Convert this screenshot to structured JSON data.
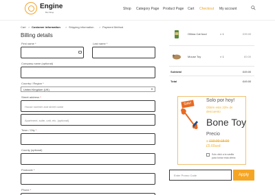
{
  "brand": {
    "name": "Engine",
    "tagline": "Bot Shop"
  },
  "nav": [
    "Shop",
    "Category Page",
    "Product Page",
    "Cart",
    "Checkout",
    "My account"
  ],
  "nav_active": "Checkout",
  "breadcrumb": {
    "items": [
      "Cart",
      "Customer information",
      "Shipping information",
      "Payment Method"
    ],
    "separator": ">"
  },
  "billing": {
    "title": "Billing details",
    "first_name_label": "First name",
    "last_name_label": "Last name",
    "company_label": "Company name (optional)",
    "country_label": "Country / Region",
    "country_value": "United Kingdom (UK)",
    "street_label": "Street address",
    "street_placeholder": "House number and street name",
    "apartment_placeholder": "Apartment, suite, unit, etc. (optional)",
    "city_label": "Town / City",
    "county_label": "County (optional)",
    "postcode_label": "Postcode",
    "phone_label": "Phone",
    "required_mark": "*"
  },
  "order": {
    "items": [
      {
        "name": "Ollima Cat food",
        "qty": "× 1",
        "price": "£39.00"
      },
      {
        "name": "Mouse Toy",
        "qty": "× 1",
        "price": "£0.00"
      }
    ],
    "subtotal_label": "Subtotal",
    "subtotal_value": "£49.00",
    "total_label": "Total",
    "total_value": "£49.00"
  },
  "promo": {
    "badge": "Sale!",
    "headline": "Solo por hoy!",
    "discount_line1": "Obtén este 33% de",
    "discount_line2": "descuento",
    "product_name": "Bone Toy",
    "price_label": "Precio",
    "old_price_prefix": "a",
    "old_price": "£10.00 £8.00",
    "new_price": "£5.60usd",
    "checkbox_line1": "Solo click a la casilla",
    "checkbox_line2": "para tomar esta oferta"
  },
  "coupon": {
    "placeholder": "Enter Promo Code",
    "button": "Apply"
  },
  "colors": {
    "accent": "#f5a524",
    "promo_text": "#f0b030",
    "sale_tag": "#e76a22"
  }
}
